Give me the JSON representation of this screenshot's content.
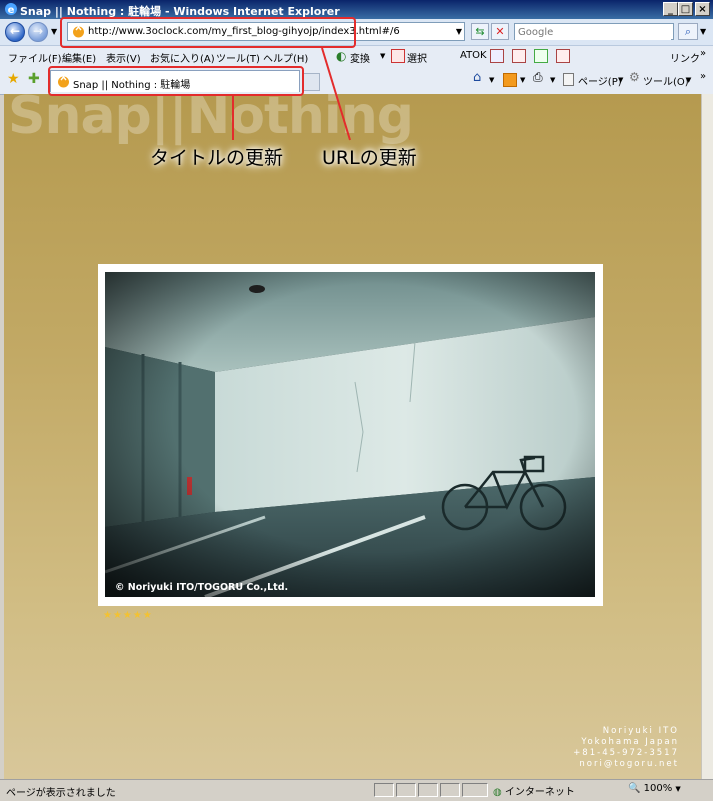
{
  "window": {
    "title": "Snap || Nothing : 駐輪場 - Windows Internet Explorer",
    "minimize": "_",
    "maximize": "□",
    "close": "×"
  },
  "address": {
    "url": "http://www.3oclock.com/my_first_blog-gihyojp/index3.html#/6",
    "search_placeholder": "Google"
  },
  "menu": {
    "items": [
      "ファイル(F)",
      "編集(E)",
      "表示(V)",
      "お気に入り(A)",
      "ツール(T)",
      "ヘルプ(H)"
    ],
    "convert": "変換",
    "select": "選択",
    "atok": "ATOK",
    "links": "リンク"
  },
  "tab": {
    "title": "Snap || Nothing : 駐輪場"
  },
  "toolbar": {
    "page": "ページ(P)",
    "tools": "ツール(O)"
  },
  "page": {
    "brand": "Snap||Nothing",
    "photo_credit": "© Noriyuki ITO/TOGORU Co.,Ltd.",
    "rating_stars": 5,
    "rating_display": "★★★★★",
    "contact": [
      "Noriyuki ITO",
      "Yokohama Japan",
      "+81-45-972-3517",
      "nori@togoru.net"
    ]
  },
  "status": {
    "text": "ページが表示されました",
    "zone": "インターネット",
    "zoom": "100%"
  },
  "annotations": {
    "title_update": "タイトルの更新",
    "url_update": "URLの更新",
    "color": "#e32c2c"
  }
}
